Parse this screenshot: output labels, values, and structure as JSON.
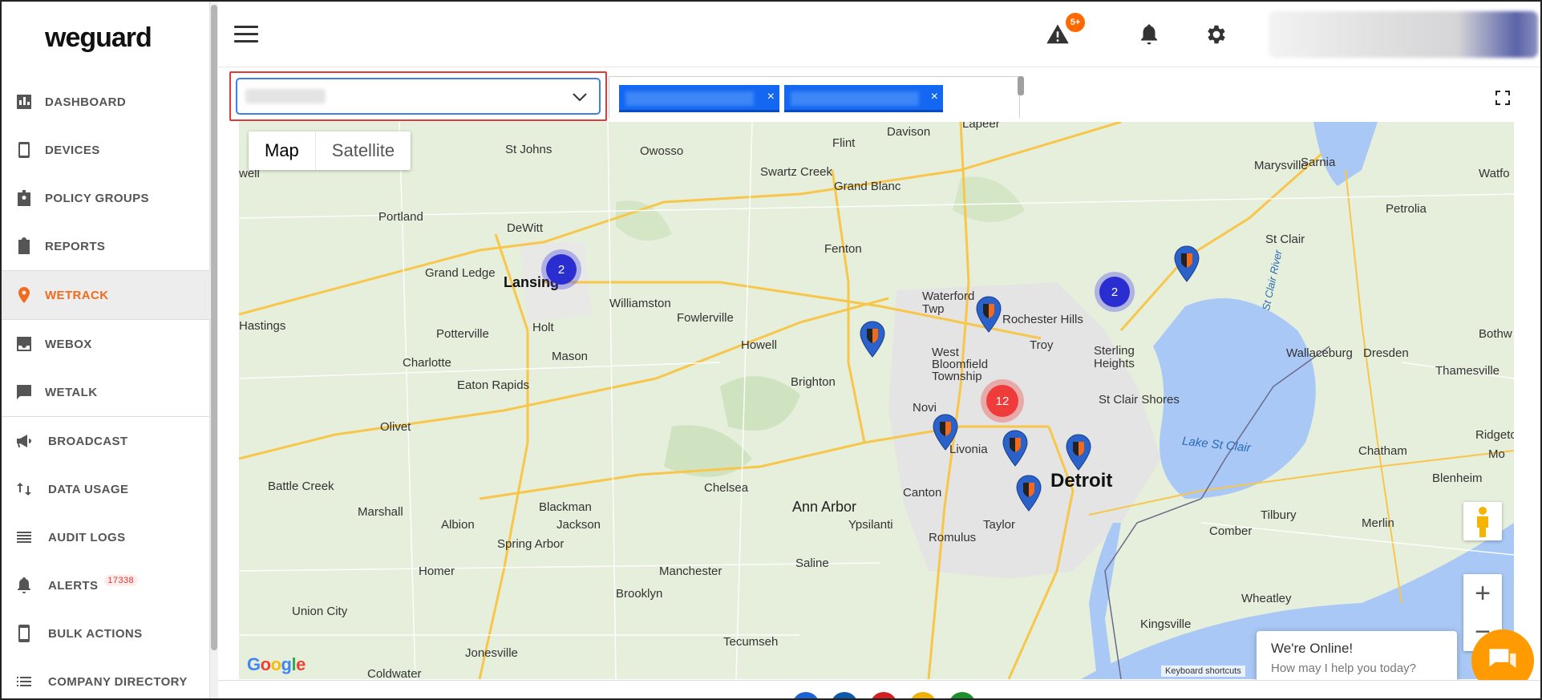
{
  "app": {
    "logo": "weguard"
  },
  "sidebar": {
    "items": [
      {
        "label": "DASHBOARD",
        "icon": "bar-chart-icon"
      },
      {
        "label": "DEVICES",
        "icon": "devices-icon"
      },
      {
        "label": "POLICY GROUPS",
        "icon": "badge-icon"
      },
      {
        "label": "REPORTS",
        "icon": "clipboard-icon"
      },
      {
        "label": "WETRACK",
        "icon": "location-pin-icon",
        "active": true
      },
      {
        "label": "WEBOX",
        "icon": "inbox-icon"
      },
      {
        "label": "WETALK",
        "icon": "chat-icon"
      },
      {
        "label": "BROADCAST",
        "icon": "megaphone-icon"
      },
      {
        "label": "DATA USAGE",
        "icon": "swap-vertical-icon"
      },
      {
        "label": "AUDIT LOGS",
        "icon": "list-icon"
      },
      {
        "label": "ALERTS",
        "icon": "alert-bell-icon",
        "badge": "17338"
      },
      {
        "label": "BULK ACTIONS",
        "icon": "phone-icon"
      },
      {
        "label": "COMPANY DIRECTORY",
        "icon": "list-bullets-icon"
      }
    ]
  },
  "topbar": {
    "alert_count": "5+"
  },
  "filters": {
    "chips_remove": "×"
  },
  "map": {
    "types": [
      "Map",
      "Satellite"
    ],
    "clusters": {
      "lansing": "2",
      "sterling": "2",
      "detroit": "12"
    },
    "cities": {
      "lansing": "Lansing",
      "detroit": "Detroit",
      "ann_arbor": "Ann Arbor",
      "st_johns": "St Johns",
      "owosso": "Owosso",
      "flint": "Flint",
      "davison": "Davison",
      "lapeer": "Lapeer",
      "swartz": "Swartz Creek",
      "grand_blanc": "Grand Blanc",
      "portland": "Portland",
      "dewitt": "DeWitt",
      "grand_ledge": "Grand Ledge",
      "fenton": "Fenton",
      "williamston": "Williamston",
      "fowlerville": "Fowlerville",
      "waterford": "Waterford\nTwp",
      "rochester": "Rochester Hills",
      "holt": "Holt",
      "hastings": "Hastings",
      "potterville": "Potterville",
      "mason": "Mason",
      "howell": "Howell",
      "troy": "Troy",
      "sterling": "Sterling\nHeights",
      "west_bloomfield": "West\nBloomfield\nTownship",
      "charlotte": "Charlotte",
      "brighton": "Brighton",
      "eaton": "Eaton Rapids",
      "st_clair_shores": "St Clair Shores",
      "novi": "Novi",
      "olivet": "Olivet",
      "livonia": "Livonia",
      "battle_creek": "Battle Creek",
      "chelsea": "Chelsea",
      "canton": "Canton",
      "marshall": "Marshall",
      "blackman": "Blackman",
      "jackson": "Jackson",
      "albion": "Albion",
      "ypsilanti": "Ypsilanti",
      "taylor": "Taylor",
      "romulus": "Romulus",
      "spring_arbor": "Spring Arbor",
      "homer": "Homer",
      "manchester": "Manchester",
      "saline": "Saline",
      "brooklyn": "Brooklyn",
      "union_city": "Union City",
      "jonesville": "Jonesville",
      "tecumseh": "Tecumseh",
      "coldwater": "Coldwater",
      "sarnia": "Sarnia",
      "marysville": "Marysville",
      "petrolia": "Petrolia",
      "st_clair": "St Clair",
      "wallaceburg": "Wallaceburg",
      "dresden": "Dresden",
      "thamesville": "Thamesville",
      "chatham": "Chatham",
      "ridgetown": "Ridgetow",
      "blenheim": "Blenheim",
      "tilbury": "Tilbury",
      "comber": "Comber",
      "merlin": "Merlin",
      "wheatley": "Wheatley",
      "kingsville": "Kingsville",
      "bothwell": "Bothw",
      "watford": "Watfo",
      "well": "well",
      "lake_st_clair": "Lake St Clair",
      "st_clair_river": "St Clair River",
      "mo": "Mo"
    },
    "keyboard_shortcuts": "Keyboard shortcuts",
    "attribution": "Google"
  },
  "chat": {
    "title": "We're Online!",
    "subtitle": "How may I help you today?"
  }
}
